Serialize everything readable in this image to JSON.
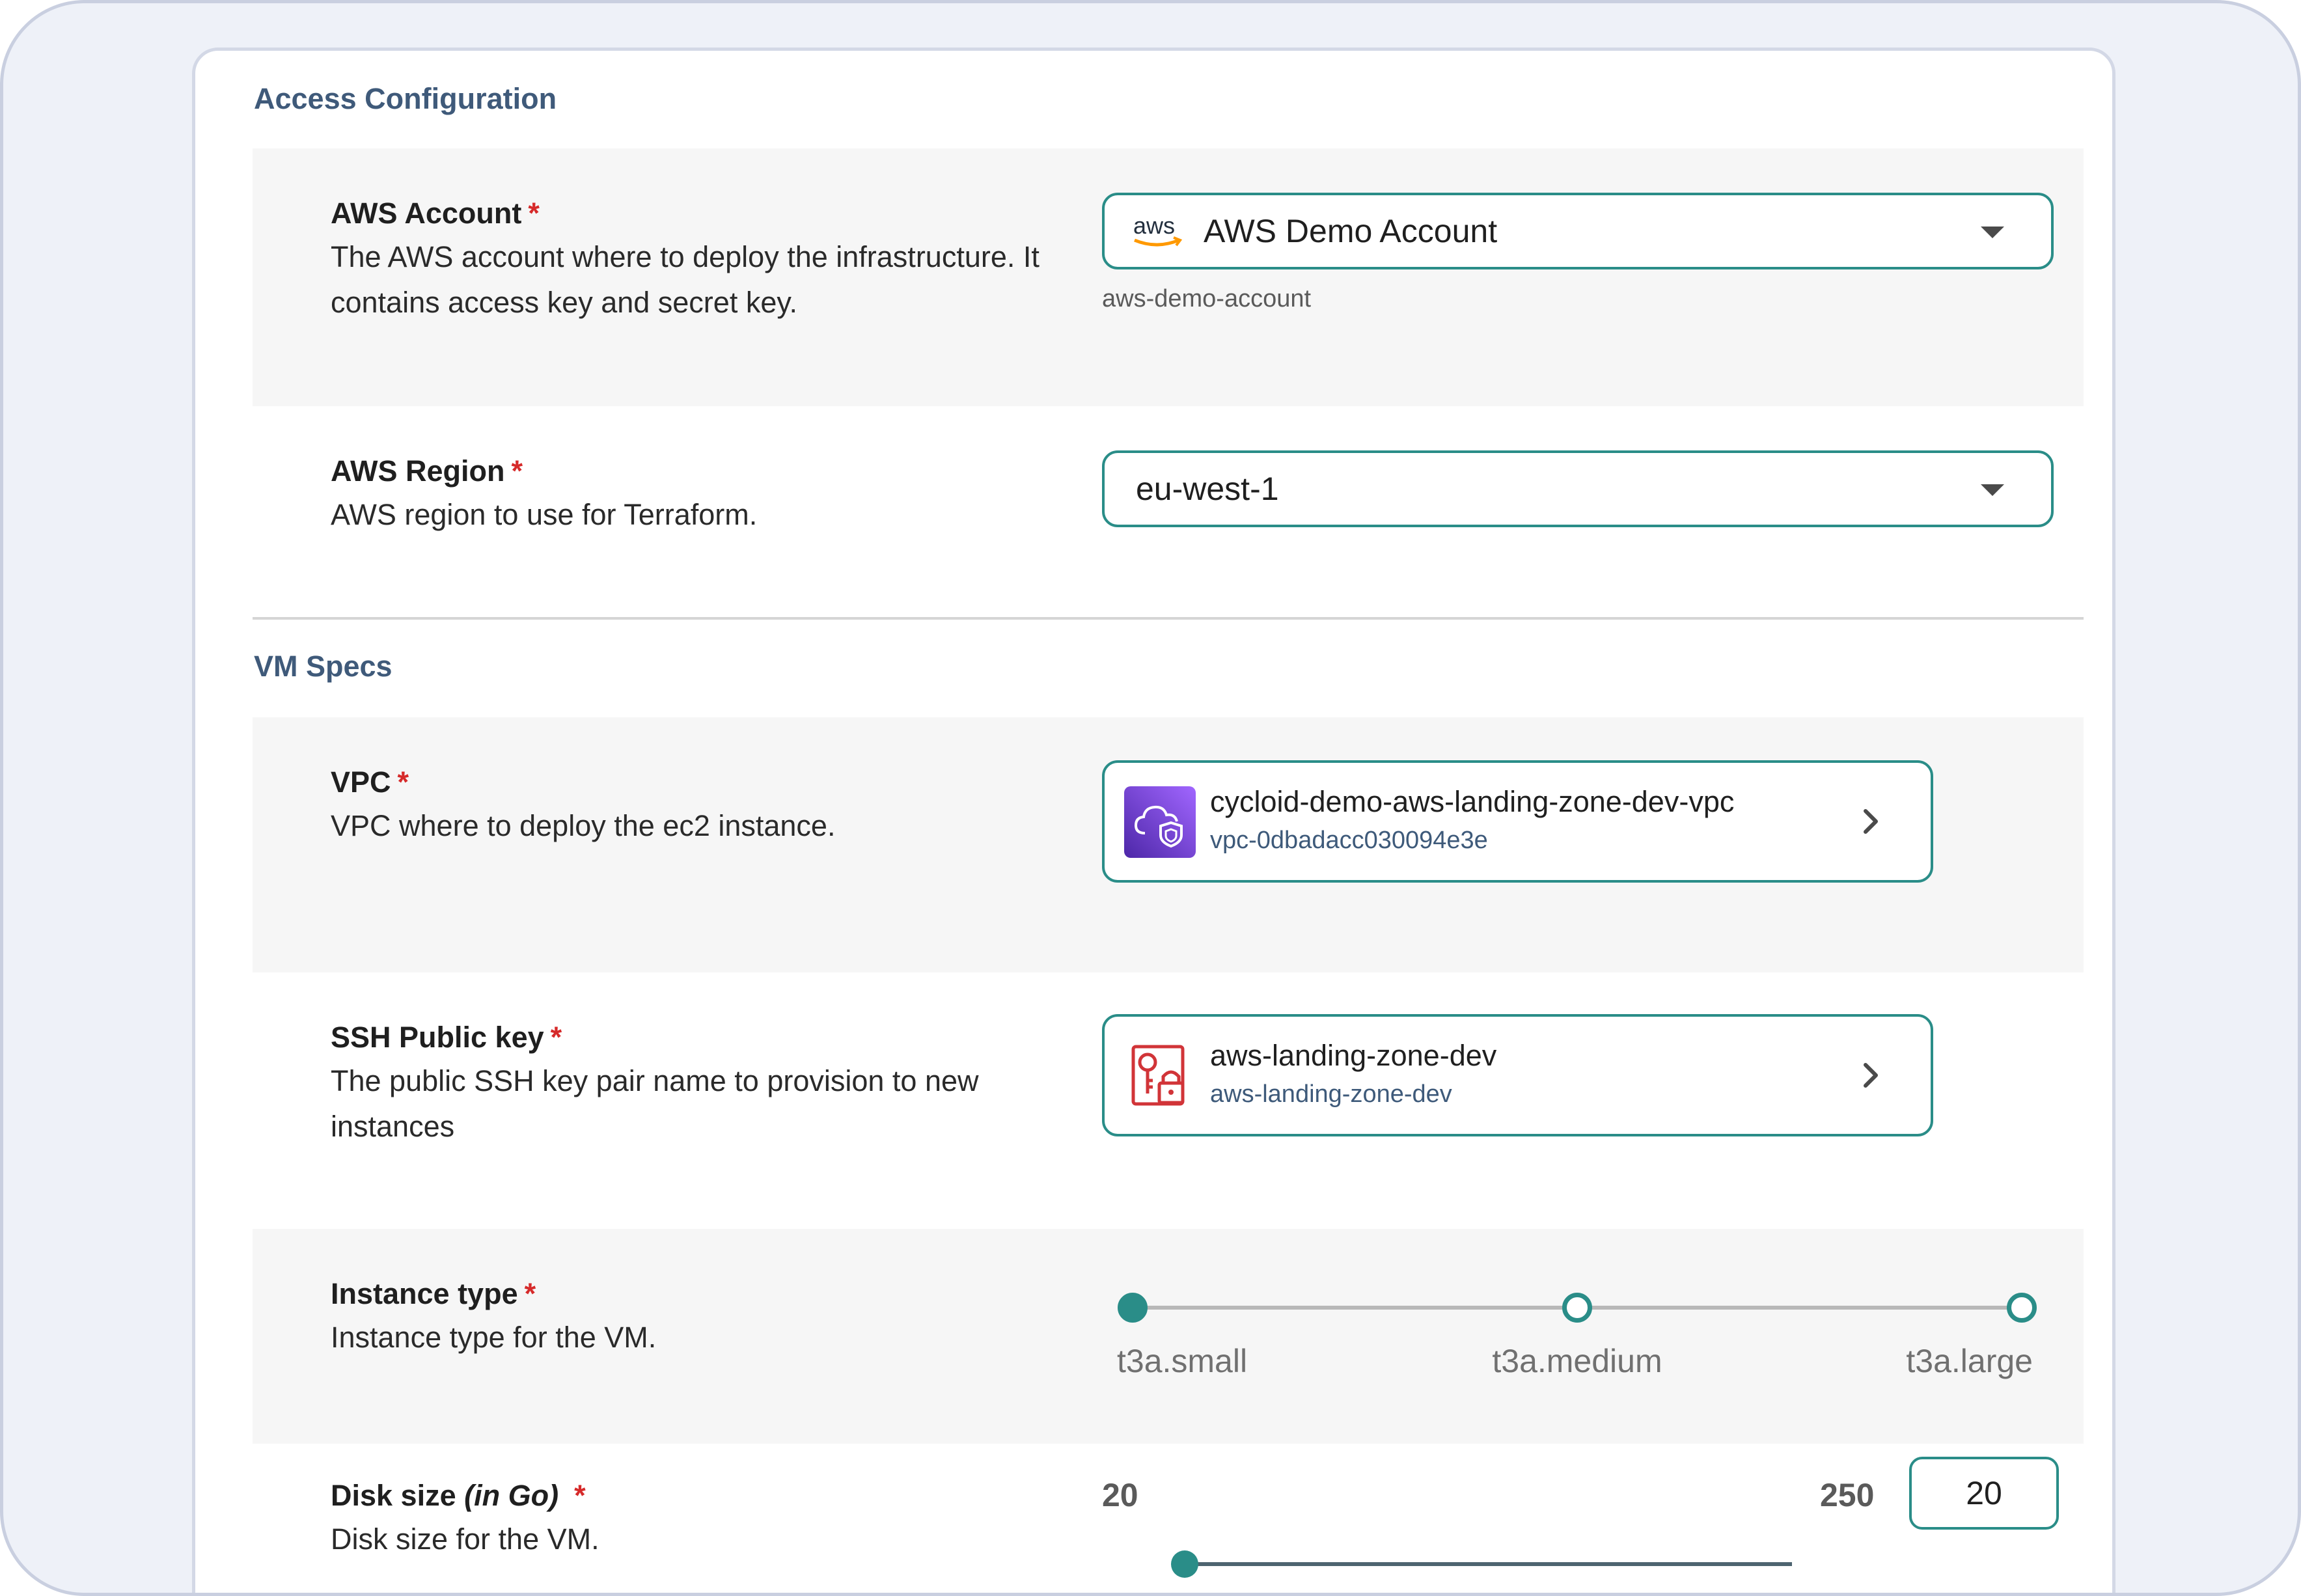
{
  "sections": {
    "access": "Access Configuration",
    "vm": "VM Specs"
  },
  "aws_account": {
    "label": "AWS Account",
    "required": "*",
    "description_line1": "The AWS account where to deploy the infrastructure. It",
    "description_line2": "contains access key and secret key.",
    "icon": "aws-logo",
    "value": "AWS Demo Account",
    "subtext": "aws-demo-account"
  },
  "aws_region": {
    "label": "AWS Region",
    "required": "*",
    "description": "AWS region to use for Terraform.",
    "value": "eu-west-1"
  },
  "vpc": {
    "label": "VPC",
    "required": "*",
    "description": "VPC where to deploy the ec2 instance.",
    "icon": "vpc-cloud-shield-icon",
    "title": "cycloid-demo-aws-landing-zone-dev-vpc",
    "sub": "vpc-0dbadacc030094e3e"
  },
  "ssh_key": {
    "label": "SSH Public key",
    "required": "*",
    "description_line1": "The public SSH key pair name to provision to new",
    "description_line2": "instances",
    "icon": "key-lock-icon",
    "title": "aws-landing-zone-dev",
    "sub": "aws-landing-zone-dev"
  },
  "instance_type": {
    "label": "Instance type",
    "required": "*",
    "description": "Instance type for the VM.",
    "options": [
      "t3a.small",
      "t3a.medium",
      "t3a.large"
    ],
    "selected": "t3a.small"
  },
  "disk_size": {
    "label": "Disk size",
    "label_unit": "(in Go)",
    "required": "*",
    "description": "Disk size for the VM.",
    "min": "20",
    "max": "250",
    "value": "20"
  },
  "colors": {
    "accent": "#2a8d88",
    "required": "#d62a2a",
    "section_title": "#3f5a7a"
  }
}
